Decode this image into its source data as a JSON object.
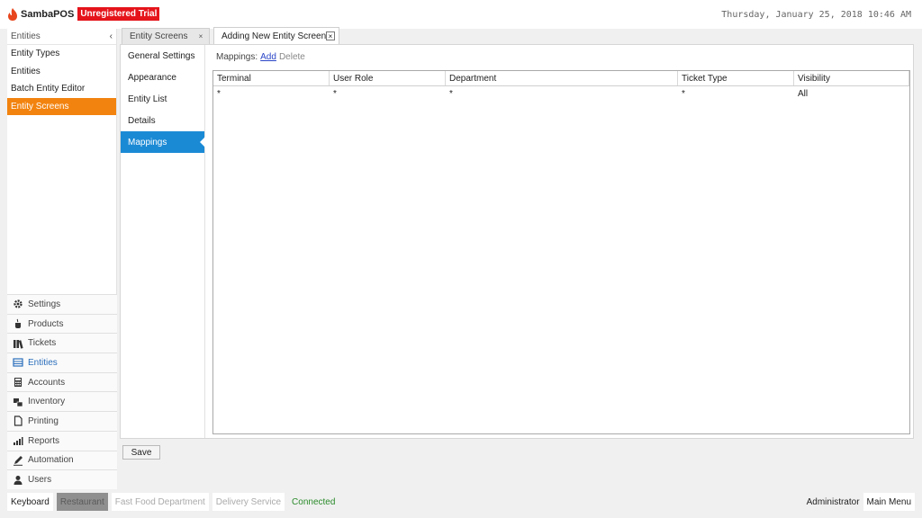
{
  "header": {
    "brand": "SambaPOS",
    "trial_badge": "Unregistered Trial",
    "datetime": "Thursday, January 25, 2018 10:46 AM"
  },
  "sidebar": {
    "section_title": "Entities",
    "collapse_glyph": "‹",
    "items": [
      {
        "label": "Entity Types"
      },
      {
        "label": "Entities"
      },
      {
        "label": "Batch Entity Editor"
      },
      {
        "label": "Entity Screens",
        "active": true
      }
    ],
    "nav": [
      {
        "label": "Settings",
        "icon": "gear-icon"
      },
      {
        "label": "Products",
        "icon": "coffee-icon"
      },
      {
        "label": "Tickets",
        "icon": "books-icon"
      },
      {
        "label": "Entities",
        "icon": "table-icon",
        "active": true
      },
      {
        "label": "Accounts",
        "icon": "calculator-icon"
      },
      {
        "label": "Inventory",
        "icon": "boxes-icon"
      },
      {
        "label": "Printing",
        "icon": "document-icon"
      },
      {
        "label": "Reports",
        "icon": "bar-chart-icon"
      },
      {
        "label": "Automation",
        "icon": "pen-icon"
      },
      {
        "label": "Users",
        "icon": "user-icon"
      }
    ]
  },
  "tabs": [
    {
      "label": "Entity Screens",
      "close": "×"
    },
    {
      "label": "Adding New Entity Screen",
      "close": "×",
      "active": true
    }
  ],
  "settings_menu": [
    {
      "label": "General Settings"
    },
    {
      "label": "Appearance"
    },
    {
      "label": "Entity List"
    },
    {
      "label": "Details"
    },
    {
      "label": "Mappings",
      "active": true
    }
  ],
  "mappings": {
    "label": "Mappings:",
    "add": "Add",
    "delete": "Delete",
    "columns": [
      "Terminal",
      "User Role",
      "Department",
      "Ticket Type",
      "Visibility"
    ],
    "rows": [
      [
        "*",
        "*",
        "*",
        "*",
        "All"
      ]
    ]
  },
  "save_label": "Save",
  "status_bar": {
    "keyboard": "Keyboard",
    "restaurant": "Restaurant",
    "fast_food": "Fast Food Department",
    "delivery": "Delivery Service",
    "connected": "Connected",
    "user": "Administrator",
    "main_menu": "Main Menu"
  },
  "colors": {
    "accent_orange": "#f2830f",
    "selected_blue": "#1b8ad5",
    "trial_red": "#e5141b",
    "connected_green": "#2a8a2a"
  }
}
